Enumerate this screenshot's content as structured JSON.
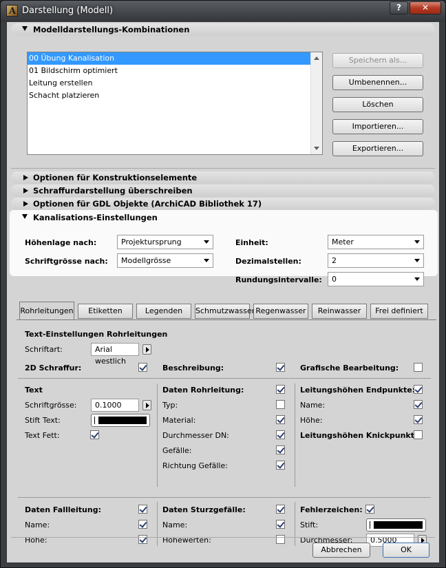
{
  "window": {
    "title": "Darstellung (Modell)",
    "help_label": "?",
    "close_label": "✕"
  },
  "section_combos": {
    "label": "Modelldarstellungs-Kombinationen"
  },
  "combo_list": {
    "items": [
      "00 Übung Kanalisation",
      "01 Bildschirm optimiert",
      "Leitung erstellen",
      "Schacht platzieren"
    ],
    "selected_index": 0
  },
  "combo_buttons": {
    "save_as": "Speichern als...",
    "rename": "Umbenennen...",
    "delete": "Löschen",
    "import": "Importieren...",
    "export": "Exportieren..."
  },
  "collapsed_sections": [
    "Optionen für Konstruktionselemente",
    "Schraffurdarstellung überschreiben",
    "Optionen für GDL Objekte (ArchiCAD Bibliothek 17)"
  ],
  "kanal": {
    "label": "Kanalisations-Einstellungen",
    "hoehenlage_label": "Höhenlage nach:",
    "hoehenlage_value": "Projektursprung",
    "schrift_label": "Schriftgrösse nach:",
    "schrift_value": "Modellgrösse",
    "einheit_label": "Einheit:",
    "einheit_value": "Meter",
    "dezimal_label": "Dezimalstellen:",
    "dezimal_value": "2",
    "rundung_label": "Rundungsintervalle:",
    "rundung_value": "0"
  },
  "tabs": [
    "Rohrleitungen",
    "Etiketten",
    "Legenden",
    "Schmutzwasser",
    "Regenwasser",
    "Reinwasser",
    "Frei definiert"
  ],
  "panel": {
    "heading": "Text-Einstellungen Rohrleitungen",
    "schriftart_label": "Schriftart:",
    "schriftart_value": "Arial westlich",
    "schraffur_label": "2D Schraffur:",
    "schraffur_checked": true,
    "beschreibung_label": "Beschreibung:",
    "beschreibung_checked": true,
    "grafisch_label": "Grafische Bearbeitung:",
    "grafisch_checked": false,
    "text_heading": "Text",
    "schriftgroesse_label": "Schriftgrösse:",
    "schriftgroesse_value": "0.1000",
    "stift_text_label": "Stift Text:",
    "text_fett_label": "Text Fett:",
    "text_fett_checked": true,
    "daten_rohr_label": "Daten Rohrleitung:",
    "daten_rohr_checked": true,
    "typ_label": "Typ:",
    "typ_checked": false,
    "material_label": "Material:",
    "material_checked": true,
    "durchmesser_label": "Durchmesser DN:",
    "durchmesser_checked": true,
    "gefaelle_label": "Gefälle:",
    "gefaelle_checked": true,
    "richtung_label": "Richtung Gefälle:",
    "richtung_checked": true,
    "endpunkte_label": "Leitungshöhen Endpunkte:",
    "endpunkte_checked": true,
    "ep_name_label": "Name:",
    "ep_name_checked": true,
    "ep_hoehe_label": "Höhe:",
    "ep_hoehe_checked": true,
    "knick_label": "Leitungshöhen Knickpunkte:",
    "knick_checked": false,
    "fall_label": "Daten Fallleitung:",
    "fall_checked": true,
    "fall_name_label": "Name:",
    "fall_name_checked": true,
    "fall_hoehe_label": "Höhe:",
    "fall_hoehe_checked": true,
    "sturz_label": "Daten Sturzgefälle:",
    "sturz_checked": true,
    "sturz_name_label": "Name:",
    "sturz_name_checked": true,
    "hoehewerten_label": "Höhewerten:",
    "hoehewerten_checked": false,
    "fehler_label": "Fehlerzeichen:",
    "fehler_checked": true,
    "stift_label": "Stift:",
    "durchmesser2_label": "Durchmesser:",
    "durchmesser2_value": "0.5000"
  },
  "footer": {
    "cancel": "Abbrechen",
    "ok": "OK"
  }
}
